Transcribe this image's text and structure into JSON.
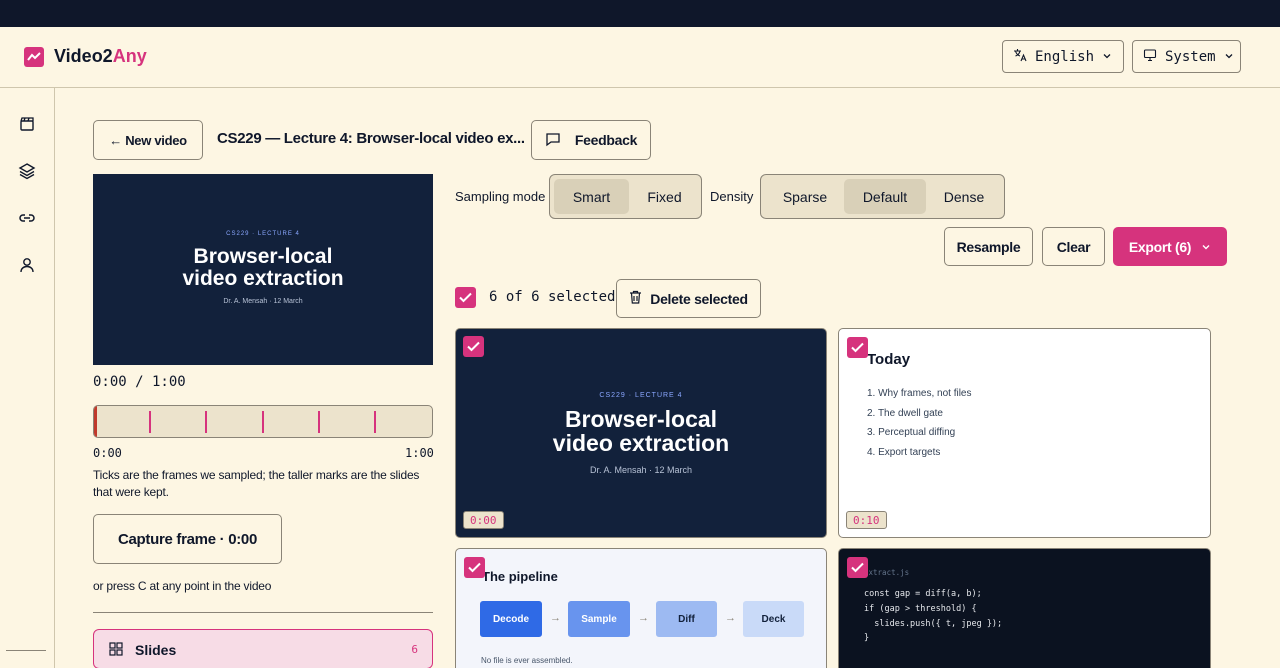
{
  "app": {
    "brand_main": "Video2",
    "brand_accent": "Any",
    "language": "English",
    "theme": "System"
  },
  "sidebar": {
    "icons": [
      "clapperboard-icon",
      "layers-icon",
      "link-icon",
      "user-icon"
    ]
  },
  "toolbar": {
    "back_label": "← New video",
    "title": "CS229 — Lecture 4: Browser-local video ex...",
    "feedback_label": "Feedback"
  },
  "player": {
    "kicker": "CS229 · LECTURE 4",
    "line1": "Browser-local",
    "line2": "video extraction",
    "byline": "Dr. A. Mensah · 12 March",
    "time_display": "0:00 / 1:00",
    "start_label": "0:00",
    "end_label": "1:00",
    "tick_times_sec": [
      10,
      20,
      30,
      40,
      50
    ],
    "duration_sec": 60,
    "hint": "Ticks are the frames we sampled; the taller marks are the slides that were kept.",
    "capture_label": "Capture frame · 0:00",
    "capture_hint": "or press C at any point in the video"
  },
  "slides_panel": {
    "label": "Slides",
    "count": "6"
  },
  "controls": {
    "sampling_label": "Sampling mode",
    "sampling_options": [
      "Smart",
      "Fixed"
    ],
    "sampling_selected": "Smart",
    "density_label": "Density",
    "density_options": [
      "Sparse",
      "Default",
      "Dense"
    ],
    "density_selected": "Default",
    "resample_label": "Resample",
    "clear_label": "Clear",
    "export_label": "Export (6)"
  },
  "selection": {
    "count_text": "6 of 6 selected",
    "delete_label": "Delete selected"
  },
  "frames": {
    "f1": {
      "time": "0:00",
      "kicker": "CS229 · LECTURE 4",
      "line1": "Browser-local",
      "line2": "video extraction",
      "byline": "Dr. A. Mensah · 12 March"
    },
    "f2": {
      "time": "0:10",
      "title": "Today",
      "items": [
        "1. Why frames, not files",
        "2. The dwell gate",
        "3. Perceptual diffing",
        "4. Export targets"
      ]
    },
    "f3": {
      "title": "The pipeline",
      "steps": [
        "Decode",
        "Sample",
        "Diff",
        "Deck"
      ],
      "note": "No file is ever assembled."
    },
    "f4": {
      "filename": "extract.js",
      "lines": [
        "const gap = diff(a, b);",
        "if (gap > threshold) {",
        "  slides.push({ t, jpeg });",
        "}"
      ]
    }
  },
  "colors": {
    "accent": "#d6337d",
    "navy": "#12213b",
    "cream": "#fdf6e3"
  }
}
